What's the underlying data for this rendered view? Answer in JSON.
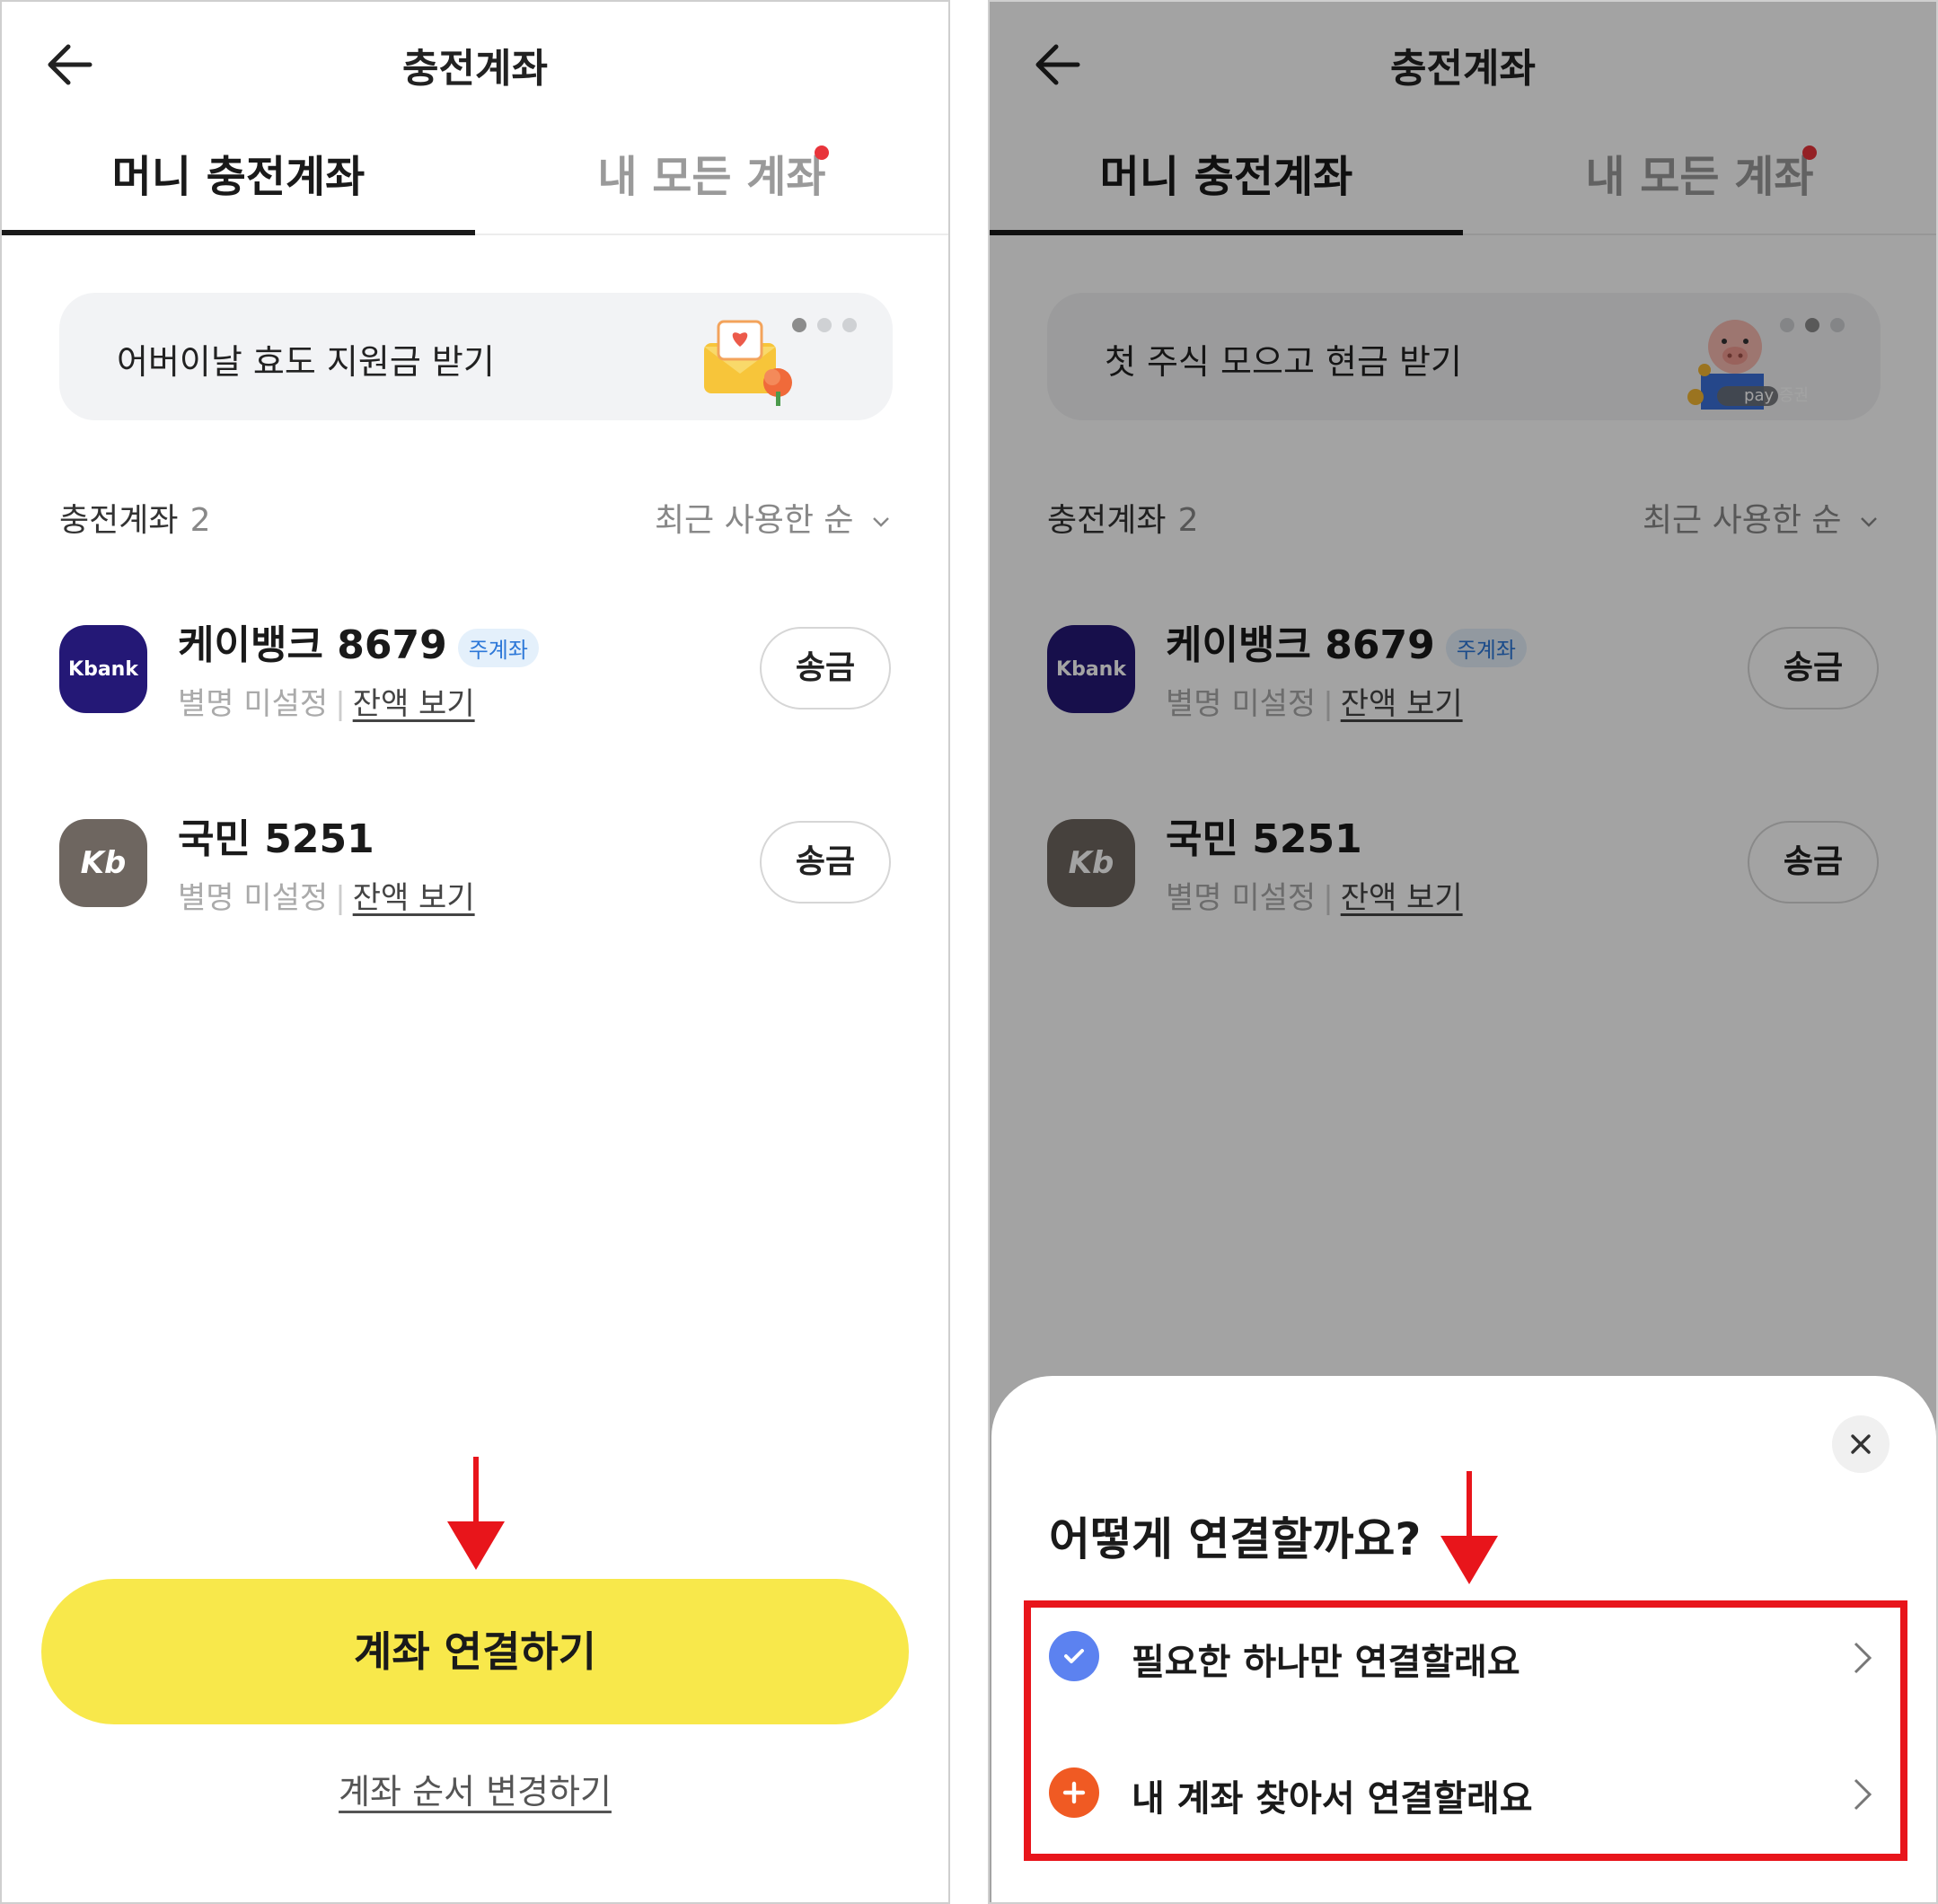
{
  "header": {
    "title": "충전계좌"
  },
  "tabs": {
    "money_account": "머니 충전계좌",
    "all_accounts": "내 모든 계좌"
  },
  "banners": {
    "left": "어버이날 효도 지원금 받기",
    "right": "첫 주식 모으고 현금 받기",
    "right_badge": "pay 증권"
  },
  "section": {
    "title": "충전계좌",
    "count": "2",
    "sort": "최근 사용한 순"
  },
  "accounts": [
    {
      "name": "케이뱅크 8679",
      "badge": "주계좌",
      "logo_text": "Kbank",
      "alias": "별명 미설정",
      "sep": "|",
      "balance_link": "잔액 보기",
      "send_label": "송금"
    },
    {
      "name": "국민 5251",
      "logo_text": "Kb",
      "alias": "별명 미설정",
      "sep": "|",
      "balance_link": "잔액 보기",
      "send_label": "송금"
    }
  ],
  "left_actions": {
    "connect": "계좌 연결하기",
    "reorder": "계좌 순서 변경하기"
  },
  "sheet": {
    "title": "어떻게 연결할까요?",
    "options": [
      {
        "label": "필요한 하나만 연결할래요",
        "icon": "check-circle-icon"
      },
      {
        "label": "내 계좌 찾아서 연결할래요",
        "icon": "plus-circle-icon"
      }
    ]
  },
  "colors": {
    "yellow": "#F8E84B",
    "kbank": "#241876",
    "kb": "#6E6660",
    "highlight_red": "#E8151B",
    "check_blue": "#5C82F0",
    "plus_orange": "#F05A23"
  }
}
